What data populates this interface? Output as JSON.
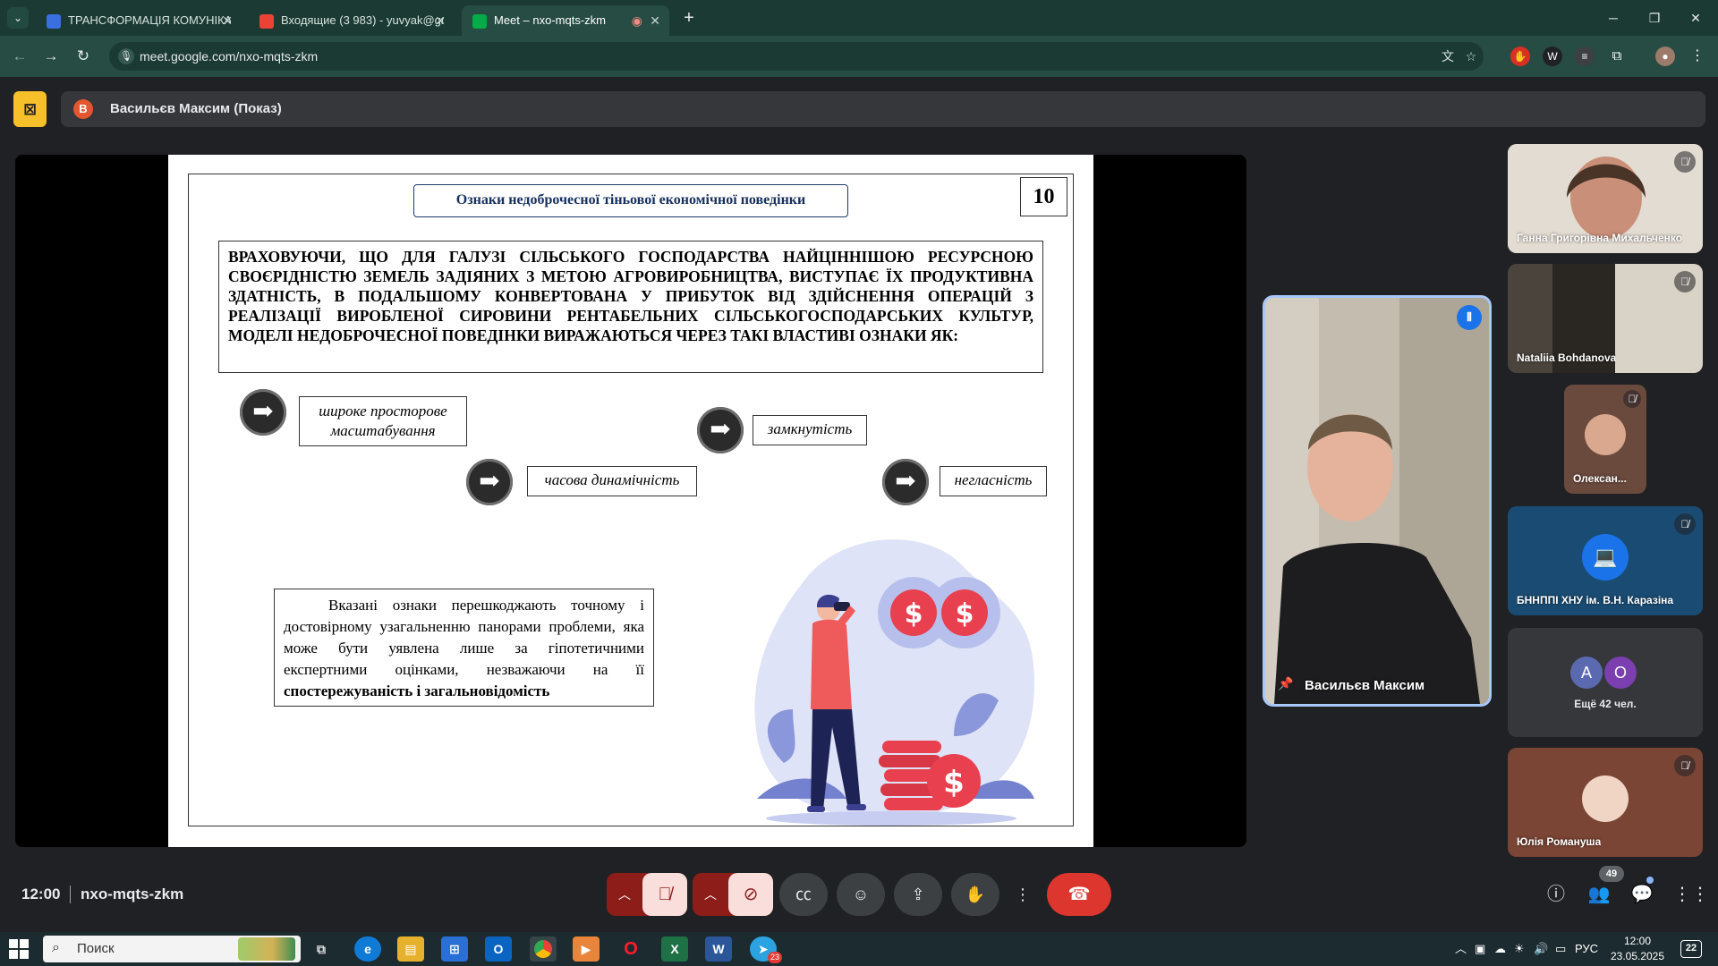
{
  "browser": {
    "tabs": [
      {
        "title": "ТРАНСФОРМАЦІЯ КОМУНІКАЦ",
        "favicon": "shield-icon",
        "color": "#3b6fe0"
      },
      {
        "title": "Входящие (3 983) - yuvyak@gm",
        "favicon": "gmail-icon",
        "color": "#ea4335"
      },
      {
        "title": "Meet – nxo-mqts-zkm",
        "favicon": "meet-icon",
        "color": "#00ac47"
      }
    ],
    "url": "meet.google.com/nxo-mqts-zkm"
  },
  "presentation": {
    "presenter_initial": "В",
    "presenter_label": "Васильєв Максим (Показ)"
  },
  "slide": {
    "title": "Ознаки недоброчесної тіньової економічної поведінки",
    "number": "10",
    "main_text": "ВРАХОВУЮЧИ, ЩО ДЛЯ ГАЛУЗІ СІЛЬСЬКОГО ГОСПОДАРСТВА НАЙЦІННІШОЮ РЕСУРСНОЮ СВОЄРІДНІСТЮ ЗЕМЕЛЬ ЗАДІЯНИХ З МЕТОЮ АГРОВИРОБНИЦТВА, ВИСТУПАЄ ЇХ ПРОДУКТИВНА ЗДАТНІСТЬ, В ПОДАЛЬШОМУ КОНВЕРТОВАНА У ПРИБУТОК ВІД ЗДІЙСНЕННЯ ОПЕРАЦІЙ З РЕАЛІЗАЦІЇ ВИРОБЛЕНОЇ СИРОВИНИ РЕНТАБЕЛЬНИХ СІЛЬСЬКОГОСПОДАРСЬКИХ КУЛЬТУР, МОДЕЛІ НЕДОБРОЧЕСНОЇ ПОВЕДІНКИ ВИРАЖАЮТЬСЯ ЧЕРЕЗ ТАКІ ВЛАСТИВІ ОЗНАКИ ЯК:",
    "features": [
      {
        "label_line1": "широке просторове",
        "label_line2": "масштабування"
      },
      {
        "label_line1": "часова динамічність",
        "label_line2": ""
      },
      {
        "label_line1": "замкнутість",
        "label_line2": ""
      },
      {
        "label_line1": "негласність",
        "label_line2": ""
      }
    ],
    "note_text": "Вказані ознаки перешкоджають точному і достовірному узагальненню панорами проблеми, яка може бути уявлена лише за гіпотетичними експертними оцінками, незважаючи на її",
    "note_bold": "спостережуваність і загальновідомість",
    "illustration": {
      "coin_symbol": "$",
      "accent": "#e8404e",
      "blob": "#d9def6"
    }
  },
  "participants": {
    "tiles": [
      {
        "name": "Ганна Григорівна Михальченко",
        "muted": true,
        "bg": "#d8cfc4"
      },
      {
        "name": "Nataliia Bohdanova",
        "muted": true,
        "bg": "#3a3530"
      },
      {
        "name": "Олексан...",
        "muted": true,
        "bg": "#6b4a3e"
      },
      {
        "name": "БННППІ ХНУ ім. В.Н. Каразіна",
        "muted": true,
        "bg": "#1a4c73"
      },
      {
        "name": "Юлія Романуша",
        "muted": true,
        "bg": "#7a4535"
      }
    ],
    "speaker": {
      "name": "Васильєв Максим"
    },
    "more": {
      "initials": [
        "А",
        "О"
      ],
      "colors": [
        "#5b6ab0",
        "#7b3fb0"
      ],
      "label": "Ещё 42 чел."
    },
    "count": "49"
  },
  "meeting": {
    "time": "12:00",
    "code": "nxo-mqts-zkm"
  },
  "taskbar": {
    "search_placeholder": "Поиск",
    "lang": "РУС",
    "time": "12:00",
    "date": "23.05.2025",
    "notifications": "22",
    "telegram_badge": "23"
  }
}
